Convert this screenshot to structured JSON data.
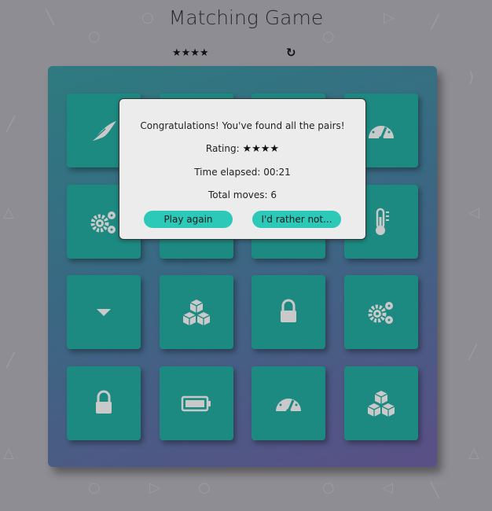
{
  "app": {
    "title": "Matching Game"
  },
  "score_panel": {
    "stars": "★★★★",
    "star_count": 4,
    "restart_icon": "restart-icon"
  },
  "modal": {
    "message": "Congratulations! You've found all the pairs!",
    "rating_label": "Rating:",
    "rating_stars": "★★★★",
    "time_label": "Time elapsed: 00:21",
    "moves_label": "Total moves: 6",
    "play_again": "Play again",
    "decline": "I'd rather not..."
  },
  "cards": [
    {
      "icon": "feather-icon"
    },
    {
      "icon": "hidden"
    },
    {
      "icon": "hidden"
    },
    {
      "icon": "gauge-icon"
    },
    {
      "icon": "gears-icon"
    },
    {
      "icon": "hidden"
    },
    {
      "icon": "hidden"
    },
    {
      "icon": "thermometer-icon"
    },
    {
      "icon": "caret-down-icon"
    },
    {
      "icon": "cubes-icon"
    },
    {
      "icon": "lock-icon"
    },
    {
      "icon": "gears-icon"
    },
    {
      "icon": "lock-icon"
    },
    {
      "icon": "battery-icon"
    },
    {
      "icon": "gauge-icon"
    },
    {
      "icon": "cubes-icon"
    }
  ],
  "colors": {
    "board_start": "#2e7b80",
    "board_end": "#5a4f86",
    "card": "#1d8a82",
    "button": "#2cc9b9",
    "icon": "#c9c9c9"
  }
}
